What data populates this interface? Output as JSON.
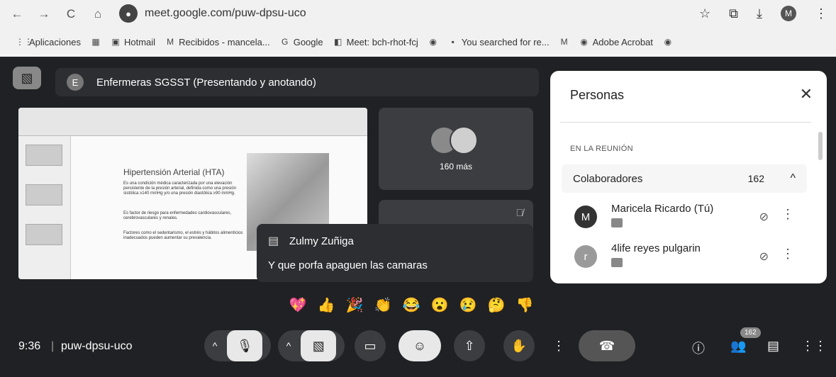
{
  "browser": {
    "url": "meet.google.com/puw-dpsu-uco",
    "nav": {
      "back": "←",
      "forward": "→",
      "reload": "C",
      "home": "⌂"
    },
    "profile_initial": "M",
    "bookmarks": [
      {
        "label": "Aplicaciones",
        "icon": "apps-grid-icon"
      },
      {
        "label": "",
        "icon": "qr-icon"
      },
      {
        "label": "Hotmail",
        "icon": "outlook-icon"
      },
      {
        "label": "Recibidos - mancela...",
        "icon": "gmail-icon"
      },
      {
        "label": "Google",
        "icon": "google-icon"
      },
      {
        "label": "Meet: bch-rhot-fcj",
        "icon": "meet-icon"
      },
      {
        "label": "",
        "icon": "chrome-icon"
      },
      {
        "label": "You searched for re...",
        "icon": "thumbnail-icon"
      },
      {
        "label": "",
        "icon": "gmail-icon"
      },
      {
        "label": "Adobe Acrobat",
        "icon": "chrome-icon"
      },
      {
        "label": "",
        "icon": "chrome-icon"
      }
    ]
  },
  "meet": {
    "presenter_initial": "E",
    "presentation_title": "Enfermeras SGSST (Presentando y anotando)",
    "slide": {
      "heading": "Hipertensión Arterial (HTA)",
      "para1": "Es una condición médica caracterizada por una elevación persistente de la presión arterial, definida como una presión sistólica ≥140 mmHg y/o una presión diastólica ≥90 mmHg.",
      "para2": "Es factor de riesgo para enfermedades cardiovasculares, cerebrovasculares y renales.",
      "para3": "Factores como el sedentarismo, el estrés y hábitos alimenticios inadecuados pueden aumentar su prevalencia."
    },
    "tile_more_label": "160 más",
    "chat": {
      "sender": "Zulmy Zuñiga",
      "message": "Y que porfa apaguen las camaras"
    },
    "people": {
      "title": "Personas",
      "section": "EN LA REUNIÓN",
      "group_label": "Colaboradores",
      "group_count": "162",
      "participants": [
        {
          "initial": "M",
          "name": "Maricela Ricardo (Tú)",
          "color": "#333333"
        },
        {
          "initial": "r",
          "name": "4life reyes pulgarin",
          "color": "#9a9a9a"
        }
      ]
    },
    "reactions": [
      "💖",
      "👍",
      "🎉",
      "👏",
      "😂",
      "😮",
      "😢",
      "🤔",
      "👎"
    ],
    "time": "9:36",
    "meeting_code": "puw-dpsu-uco",
    "participant_badge": "162"
  }
}
